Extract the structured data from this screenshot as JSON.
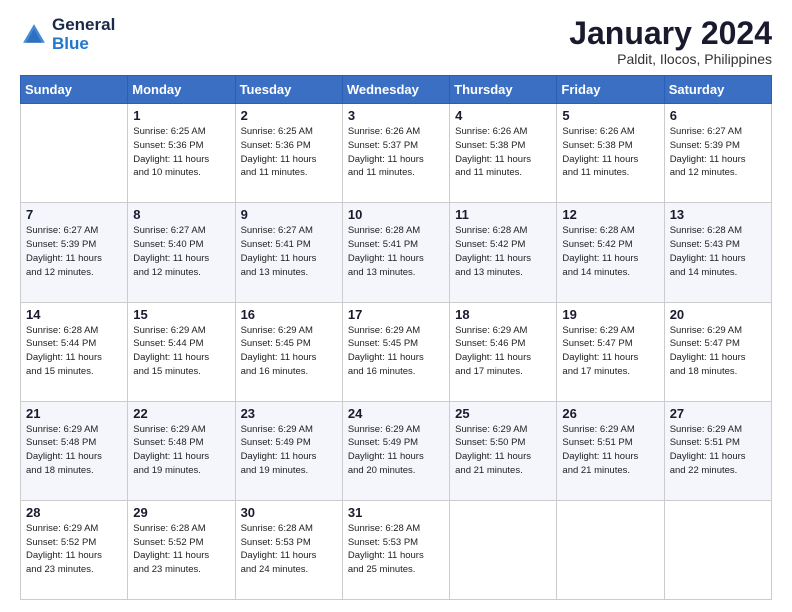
{
  "header": {
    "logo_line1": "General",
    "logo_line2": "Blue",
    "title": "January 2024",
    "subtitle": "Paldit, Ilocos, Philippines"
  },
  "calendar": {
    "days_of_week": [
      "Sunday",
      "Monday",
      "Tuesday",
      "Wednesday",
      "Thursday",
      "Friday",
      "Saturday"
    ],
    "weeks": [
      [
        {
          "day": "",
          "info": ""
        },
        {
          "day": "1",
          "info": "Sunrise: 6:25 AM\nSunset: 5:36 PM\nDaylight: 11 hours\nand 10 minutes."
        },
        {
          "day": "2",
          "info": "Sunrise: 6:25 AM\nSunset: 5:36 PM\nDaylight: 11 hours\nand 11 minutes."
        },
        {
          "day": "3",
          "info": "Sunrise: 6:26 AM\nSunset: 5:37 PM\nDaylight: 11 hours\nand 11 minutes."
        },
        {
          "day": "4",
          "info": "Sunrise: 6:26 AM\nSunset: 5:38 PM\nDaylight: 11 hours\nand 11 minutes."
        },
        {
          "day": "5",
          "info": "Sunrise: 6:26 AM\nSunset: 5:38 PM\nDaylight: 11 hours\nand 11 minutes."
        },
        {
          "day": "6",
          "info": "Sunrise: 6:27 AM\nSunset: 5:39 PM\nDaylight: 11 hours\nand 12 minutes."
        }
      ],
      [
        {
          "day": "7",
          "info": "Sunrise: 6:27 AM\nSunset: 5:39 PM\nDaylight: 11 hours\nand 12 minutes."
        },
        {
          "day": "8",
          "info": "Sunrise: 6:27 AM\nSunset: 5:40 PM\nDaylight: 11 hours\nand 12 minutes."
        },
        {
          "day": "9",
          "info": "Sunrise: 6:27 AM\nSunset: 5:41 PM\nDaylight: 11 hours\nand 13 minutes."
        },
        {
          "day": "10",
          "info": "Sunrise: 6:28 AM\nSunset: 5:41 PM\nDaylight: 11 hours\nand 13 minutes."
        },
        {
          "day": "11",
          "info": "Sunrise: 6:28 AM\nSunset: 5:42 PM\nDaylight: 11 hours\nand 13 minutes."
        },
        {
          "day": "12",
          "info": "Sunrise: 6:28 AM\nSunset: 5:42 PM\nDaylight: 11 hours\nand 14 minutes."
        },
        {
          "day": "13",
          "info": "Sunrise: 6:28 AM\nSunset: 5:43 PM\nDaylight: 11 hours\nand 14 minutes."
        }
      ],
      [
        {
          "day": "14",
          "info": "Sunrise: 6:28 AM\nSunset: 5:44 PM\nDaylight: 11 hours\nand 15 minutes."
        },
        {
          "day": "15",
          "info": "Sunrise: 6:29 AM\nSunset: 5:44 PM\nDaylight: 11 hours\nand 15 minutes."
        },
        {
          "day": "16",
          "info": "Sunrise: 6:29 AM\nSunset: 5:45 PM\nDaylight: 11 hours\nand 16 minutes."
        },
        {
          "day": "17",
          "info": "Sunrise: 6:29 AM\nSunset: 5:45 PM\nDaylight: 11 hours\nand 16 minutes."
        },
        {
          "day": "18",
          "info": "Sunrise: 6:29 AM\nSunset: 5:46 PM\nDaylight: 11 hours\nand 17 minutes."
        },
        {
          "day": "19",
          "info": "Sunrise: 6:29 AM\nSunset: 5:47 PM\nDaylight: 11 hours\nand 17 minutes."
        },
        {
          "day": "20",
          "info": "Sunrise: 6:29 AM\nSunset: 5:47 PM\nDaylight: 11 hours\nand 18 minutes."
        }
      ],
      [
        {
          "day": "21",
          "info": "Sunrise: 6:29 AM\nSunset: 5:48 PM\nDaylight: 11 hours\nand 18 minutes."
        },
        {
          "day": "22",
          "info": "Sunrise: 6:29 AM\nSunset: 5:48 PM\nDaylight: 11 hours\nand 19 minutes."
        },
        {
          "day": "23",
          "info": "Sunrise: 6:29 AM\nSunset: 5:49 PM\nDaylight: 11 hours\nand 19 minutes."
        },
        {
          "day": "24",
          "info": "Sunrise: 6:29 AM\nSunset: 5:49 PM\nDaylight: 11 hours\nand 20 minutes."
        },
        {
          "day": "25",
          "info": "Sunrise: 6:29 AM\nSunset: 5:50 PM\nDaylight: 11 hours\nand 21 minutes."
        },
        {
          "day": "26",
          "info": "Sunrise: 6:29 AM\nSunset: 5:51 PM\nDaylight: 11 hours\nand 21 minutes."
        },
        {
          "day": "27",
          "info": "Sunrise: 6:29 AM\nSunset: 5:51 PM\nDaylight: 11 hours\nand 22 minutes."
        }
      ],
      [
        {
          "day": "28",
          "info": "Sunrise: 6:29 AM\nSunset: 5:52 PM\nDaylight: 11 hours\nand 23 minutes."
        },
        {
          "day": "29",
          "info": "Sunrise: 6:28 AM\nSunset: 5:52 PM\nDaylight: 11 hours\nand 23 minutes."
        },
        {
          "day": "30",
          "info": "Sunrise: 6:28 AM\nSunset: 5:53 PM\nDaylight: 11 hours\nand 24 minutes."
        },
        {
          "day": "31",
          "info": "Sunrise: 6:28 AM\nSunset: 5:53 PM\nDaylight: 11 hours\nand 25 minutes."
        },
        {
          "day": "",
          "info": ""
        },
        {
          "day": "",
          "info": ""
        },
        {
          "day": "",
          "info": ""
        }
      ]
    ]
  }
}
